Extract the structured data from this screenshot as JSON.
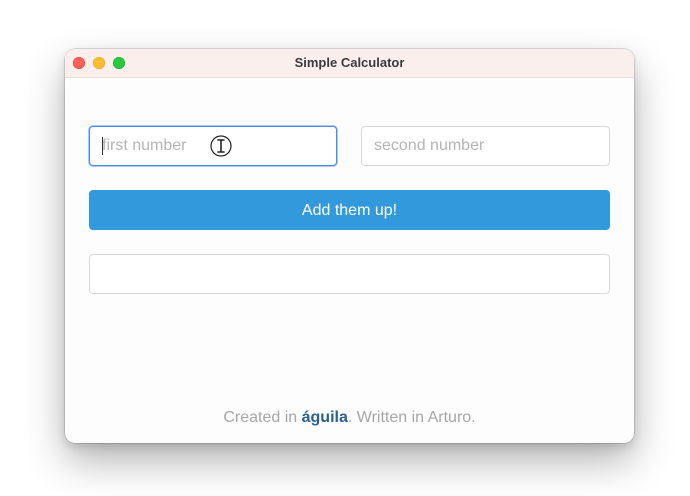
{
  "window": {
    "title": "Simple Calculator"
  },
  "form": {
    "first_number_placeholder": "first number",
    "first_number_value": "",
    "second_number_placeholder": "second number",
    "second_number_value": "",
    "submit_label": "Add them up!",
    "result_value": ""
  },
  "footer": {
    "prefix": "Created in ",
    "brand": "águila",
    "middle": ". Written in ",
    "language": "Arturo",
    "suffix": "."
  },
  "colors": {
    "accent": "#3299dc",
    "brand": "#2d5f8f",
    "titlebar": "#fbefee",
    "focus_ring": "#4a90e2"
  },
  "icons": {
    "close": "close-icon",
    "minimize": "minimize-icon",
    "zoom": "zoom-icon",
    "cursor": "text-cursor-icon"
  }
}
